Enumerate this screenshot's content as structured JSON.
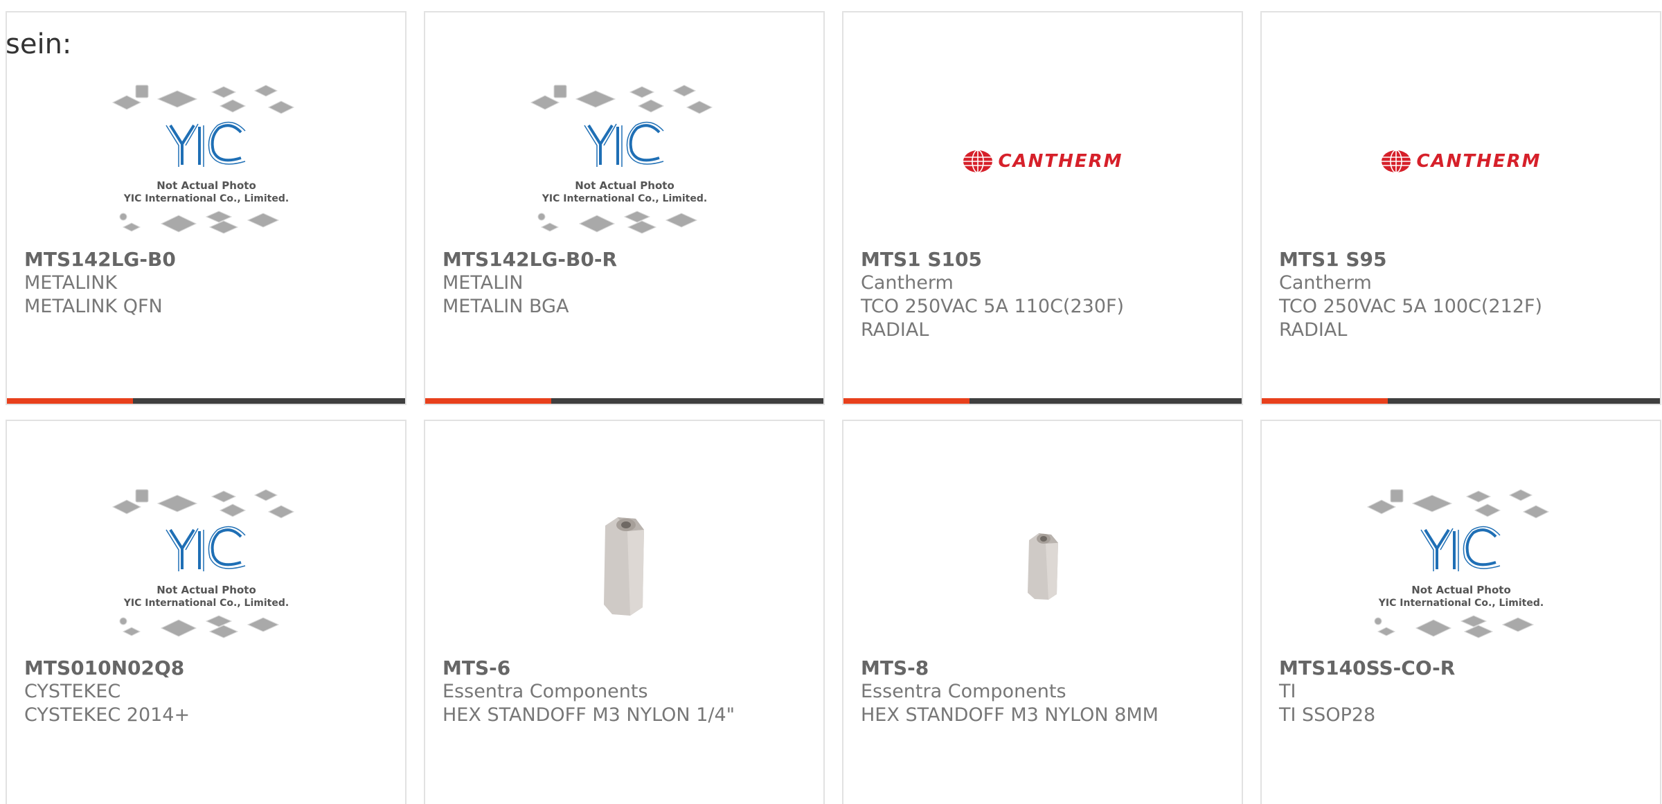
{
  "intro_text": "sein:",
  "products": [
    {
      "part_number": "MTS142LG-B0",
      "manufacturer": "METALINK",
      "lines": [
        "METALINK QFN"
      ],
      "image": "yic-placeholder",
      "image_text": [
        "Not Actual Photo",
        "YIC International Co., Limited."
      ]
    },
    {
      "part_number": "MTS142LG-B0-R",
      "manufacturer": "METALIN",
      "lines": [
        "METALIN BGA"
      ],
      "image": "yic-placeholder",
      "image_text": [
        "Not Actual Photo",
        "YIC International Co., Limited."
      ]
    },
    {
      "part_number": "MTS1 S105",
      "manufacturer": "Cantherm",
      "lines": [
        "TCO 250VAC 5A 110C(230F)",
        "RADIAL"
      ],
      "image": "cantherm-logo",
      "image_text": [
        "CANTHERM"
      ]
    },
    {
      "part_number": "MTS1 S95",
      "manufacturer": "Cantherm",
      "lines": [
        "TCO 250VAC 5A 100C(212F)",
        "RADIAL"
      ],
      "image": "cantherm-logo",
      "image_text": [
        "CANTHERM"
      ]
    },
    {
      "part_number": "MTS010N02Q8",
      "manufacturer": "CYSTEKEC",
      "lines": [
        "CYSTEKEC 2014+"
      ],
      "image": "yic-placeholder",
      "image_text": [
        "Not Actual Photo",
        "YIC International Co., Limited."
      ]
    },
    {
      "part_number": "MTS-6",
      "manufacturer": "Essentra Components",
      "lines": [
        "HEX STANDOFF M3 NYLON 1/4\""
      ],
      "image": "hex-standoff-large"
    },
    {
      "part_number": "MTS-8",
      "manufacturer": "Essentra Components",
      "lines": [
        "HEX STANDOFF M3 NYLON 8MM"
      ],
      "image": "hex-standoff-small"
    },
    {
      "part_number": "MTS140SS-CO-R",
      "manufacturer": "TI",
      "lines": [
        "TI SSOP28"
      ],
      "image": "yic-placeholder",
      "image_text": [
        "Not Actual Photo",
        "YIC International Co., Limited."
      ]
    }
  ],
  "colors": {
    "accent": "#e8401c",
    "bar": "#3f3f3f",
    "card_border": "#e2e2e2",
    "yic_blue": "#1f6fb5",
    "cantherm_red": "#d6202a"
  }
}
